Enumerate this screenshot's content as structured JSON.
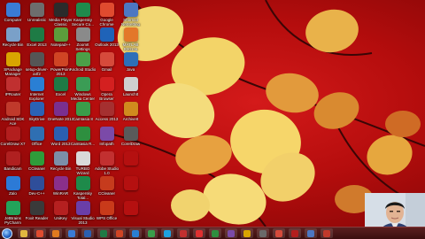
{
  "desktop_icons": [
    {
      "name": "computer-icon",
      "label": "Computer",
      "color": "#3a7bd5"
    },
    {
      "name": "unknown-icon",
      "label": "Unrealistic",
      "color": "#6d6d6d"
    },
    {
      "name": "media-player-icon",
      "label": "Media Player Classic",
      "color": "#2b2b2b"
    },
    {
      "name": "kaspersky-icon",
      "label": "Kaspersky Secure Co...",
      "color": "#1f8a4c"
    },
    {
      "name": "chrome-icon",
      "label": "Google Chrome",
      "color": "#e04b2f"
    },
    {
      "name": "shortcut-icon",
      "label": "Shortcut NetSetting",
      "color": "#4d77c2"
    },
    {
      "name": "recycle-bin-icon",
      "label": "Recycle Bin",
      "color": "#7aa0c8"
    },
    {
      "name": "excel-icon",
      "label": "Excel 2013",
      "color": "#1e7b45"
    },
    {
      "name": "notepad-icon",
      "label": "Notepad++",
      "color": "#5c9d3c"
    },
    {
      "name": "settings-icon",
      "label": "ZoomIt Settings",
      "color": "#8a8a8a"
    },
    {
      "name": "outlook-icon",
      "label": "Outlook 2013",
      "color": "#1f63b8"
    },
    {
      "name": "matlab-icon",
      "label": "MATLAB R2014a",
      "color": "#e3772a"
    },
    {
      "name": "package-manager-icon",
      "label": "SPackage Manager",
      "color": "#d9a400"
    },
    {
      "name": "setup-icon",
      "label": "setup-driver-a4f2",
      "color": "#555555"
    },
    {
      "name": "powerpoint-icon",
      "label": "PowerPoint 2013",
      "color": "#d04424"
    },
    {
      "name": "android-studio-icon",
      "label": "Android Studio",
      "color": "#4c9f48"
    },
    {
      "name": "gmail-icon",
      "label": "Gmail",
      "color": "#d64a3b"
    },
    {
      "name": "java-icon",
      "label": "Java",
      "color": "#2d6fb8"
    },
    {
      "name": "ip-router-icon",
      "label": "IPRouter",
      "color": "#c03030"
    },
    {
      "name": "internet-explorer-icon",
      "label": "Internet Explorer",
      "color": "#2a7fd4"
    },
    {
      "name": "excel-2-icon",
      "label": "Excel",
      "color": "#1e7b45"
    },
    {
      "name": "media-center-icon",
      "label": "Windows Media Center",
      "color": "#3b9c55"
    },
    {
      "name": "opera-icon",
      "label": "Opera Browser",
      "color": "#d42020"
    },
    {
      "name": "app-icon",
      "label": "LaunchIt",
      "color": "#cfcfcf"
    },
    {
      "name": "android-sdk-icon",
      "label": "Android SDK Ace",
      "color": "#c0392b"
    },
    {
      "name": "skydrive-icon",
      "label": "SkyDrive",
      "color": "#2b62b5"
    },
    {
      "name": "onenote-icon",
      "label": "OneNote 2013",
      "color": "#7a2f8f"
    },
    {
      "name": "camtasia-icon",
      "label": "Camtasia 8",
      "color": "#3a9d4a"
    },
    {
      "name": "access-icon",
      "label": "Access 2013",
      "color": "#a53030"
    },
    {
      "name": "reply-icon",
      "label": "ArchiveIt",
      "color": "#d08a1e"
    },
    {
      "name": "coredraw-icon",
      "label": "CorelDraw X7",
      "color": "#b31e1e"
    },
    {
      "name": "office-icon",
      "label": "Office",
      "color": "#2f6fb2"
    },
    {
      "name": "word-icon",
      "label": "Word 2013",
      "color": "#2b5fb0"
    },
    {
      "name": "camtasia-recorder-icon",
      "label": "Camtasia R...",
      "color": "#2e8f3f"
    },
    {
      "name": "tools-icon",
      "label": "Infopath",
      "color": "#7b4aa8"
    },
    {
      "name": "vlc-icon",
      "label": "CorelDraw",
      "color": "#5a5a5a"
    },
    {
      "name": "bandicam-icon",
      "label": "Bandicam",
      "color": "#b02020"
    },
    {
      "name": "c-cleaner-icon",
      "label": "CCleaner",
      "color": "#2f9c3a"
    },
    {
      "name": "recycle-files-icon",
      "label": "Recycle Bin",
      "color": "#7c8fa8"
    },
    {
      "name": "turbo-c-icon",
      "label": "TURBO Wizard",
      "color": "#d9d9d9"
    },
    {
      "name": "keygen-icon",
      "label": "Adobe Studio 1.0",
      "color": "#c23030"
    },
    {
      "name": "blank-icon",
      "label": "",
      "color": "#b51010"
    },
    {
      "name": "zalo-icon",
      "label": "Zalo",
      "color": "#2c7ad6"
    },
    {
      "name": "dev-c-icon",
      "label": "Dev-C++",
      "color": "#2f4e9a"
    },
    {
      "name": "winrar-icon",
      "label": "WinRAR",
      "color": "#8a2f8a"
    },
    {
      "name": "kaspersky-2-icon",
      "label": "Kaspersky Total...",
      "color": "#1e8a4a"
    },
    {
      "name": "ccleaner-icon",
      "label": "CCleaner",
      "color": "#c63b1d"
    },
    {
      "name": "blank-2-icon",
      "label": "",
      "color": "#b51010"
    },
    {
      "name": "pycharm-icon",
      "label": "JetBrains PyCharm",
      "color": "#23a35a"
    },
    {
      "name": "foxit-icon",
      "label": "Foxit Reader",
      "color": "#3a3a3a"
    },
    {
      "name": "unikey-icon",
      "label": "UniKey",
      "color": "#b52020"
    },
    {
      "name": "visual-studio-icon",
      "label": "Visual Studio 2013",
      "color": "#6a3ea8"
    },
    {
      "name": "wps-icon",
      "label": "WPS Office",
      "color": "#c93a1a"
    },
    {
      "name": "blank-3-icon",
      "label": "",
      "color": "#b51010"
    }
  ],
  "taskbar_buttons": [
    {
      "name": "taskbar-folder-icon",
      "color": "#e1b740"
    },
    {
      "name": "taskbar-chrome-icon",
      "color": "#e04b2f"
    },
    {
      "name": "taskbar-firefox-icon",
      "color": "#e07a1f"
    },
    {
      "name": "taskbar-media-icon",
      "color": "#3a7bd5"
    },
    {
      "name": "taskbar-word-icon",
      "color": "#2b5fb0"
    },
    {
      "name": "taskbar-excel-icon",
      "color": "#1e7b45"
    },
    {
      "name": "taskbar-powerpoint-icon",
      "color": "#d04424"
    },
    {
      "name": "taskbar-explorer-icon",
      "color": "#2a7fd4"
    },
    {
      "name": "taskbar-green-icon",
      "color": "#3a9d4a"
    },
    {
      "name": "taskbar-skype-icon",
      "color": "#1ea1e0"
    },
    {
      "name": "taskbar-player-icon",
      "color": "#c23030"
    },
    {
      "name": "taskbar-record-icon",
      "color": "#e03030"
    },
    {
      "name": "taskbar-app-icon",
      "color": "#2e8f3f"
    },
    {
      "name": "taskbar-app2-icon",
      "color": "#7b4aa8"
    },
    {
      "name": "taskbar-app3-icon",
      "color": "#d9a400"
    },
    {
      "name": "taskbar-app4-icon",
      "color": "#6a6a6a"
    },
    {
      "name": "taskbar-app5-icon",
      "color": "#d64a3b"
    },
    {
      "name": "taskbar-app6-icon",
      "color": "#b31e1e"
    },
    {
      "name": "taskbar-app7-icon",
      "color": "#4d77c2"
    },
    {
      "name": "taskbar-app8-icon",
      "color": "#c0392b"
    }
  ]
}
